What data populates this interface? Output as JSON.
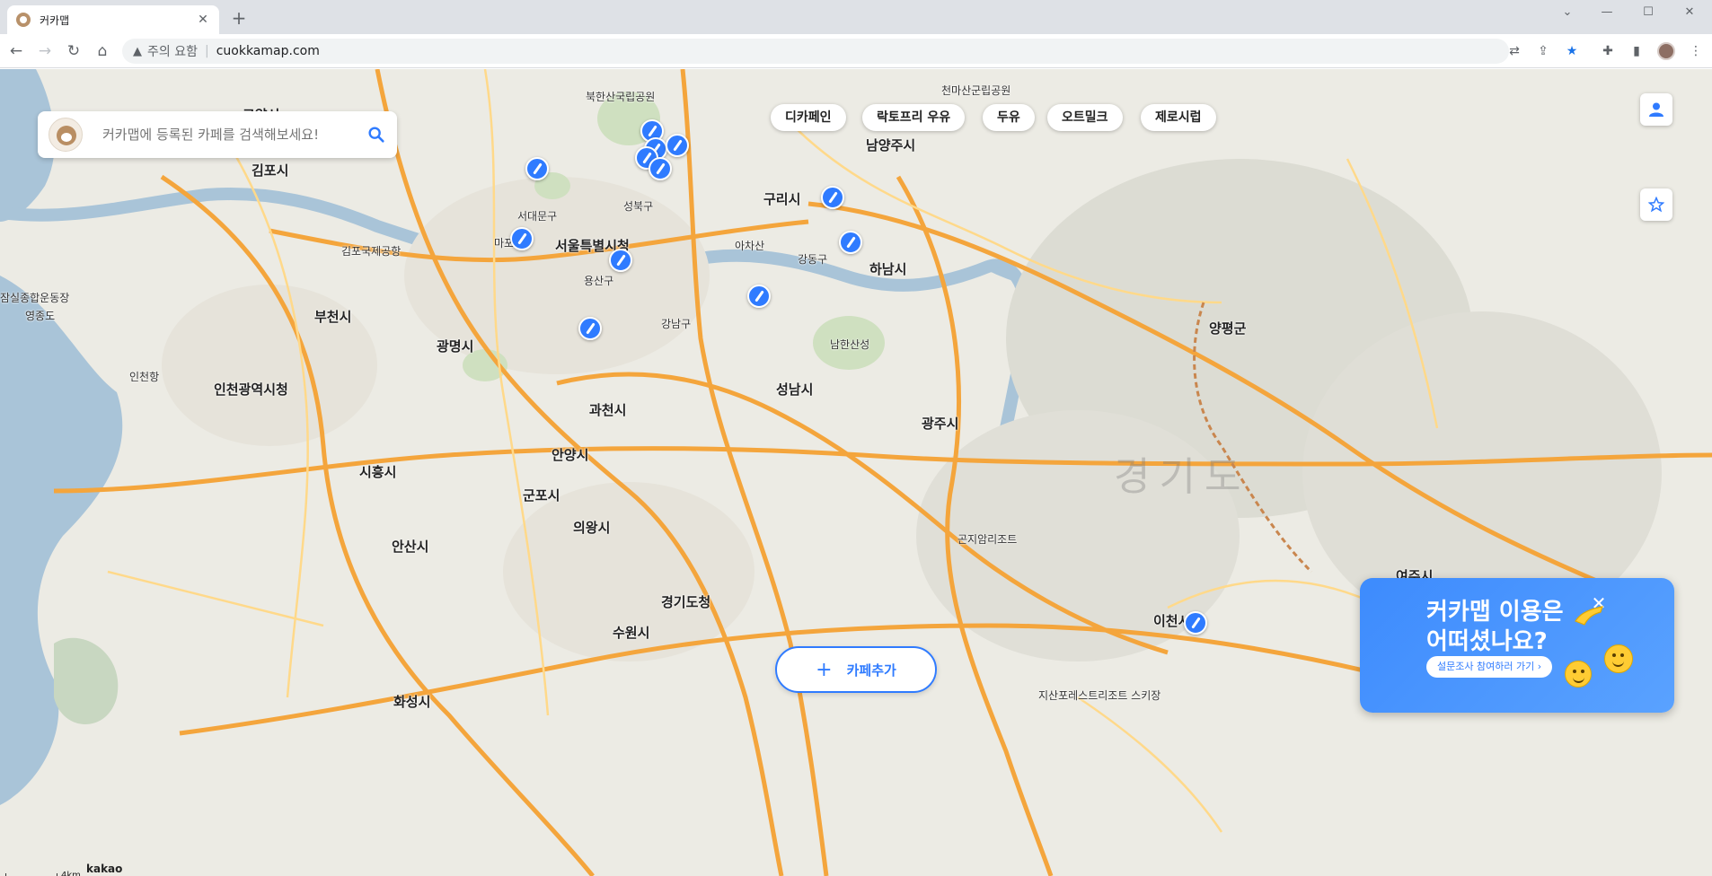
{
  "browser": {
    "tab_title": "커카맵",
    "tab_close": "✕",
    "new_tab": "+",
    "security_warning": "주의 요함",
    "url": "cuokkamap.com"
  },
  "search": {
    "placeholder": "커카맵에 등록된 카페를 검색해보세요!"
  },
  "filters": [
    "디카페인",
    "락토프리 우유",
    "두유",
    "오트밀크",
    "제로시럽"
  ],
  "add_cafe": {
    "label": "카페추가",
    "plus": "+"
  },
  "survey": {
    "line1": "커카맵 이용은",
    "line2": "어떠셨나요?",
    "cta": "설문조사 참여하러 가기 ›",
    "close": "✕"
  },
  "map": {
    "labels": {
      "seoul": "서울특별시청",
      "incheon": "인천광역시청",
      "gyeonggi_office": "경기도청",
      "gyeonggi": "경기도",
      "goyang": "고양시",
      "gimpo": "김포시",
      "bucheon": "부천시",
      "gwangmyeong": "광명시",
      "guri": "구리시",
      "namyangju": "남양주시",
      "hanam": "하남시",
      "seongnam": "성남시",
      "gwangju": "광주시",
      "gwacheon": "과천시",
      "anyang": "안양시",
      "gunpo": "군포시",
      "uiwang": "의왕시",
      "siheung": "시흥시",
      "ansan": "안산시",
      "suwon": "수원시",
      "hwaseong": "화성시",
      "yangpyeong": "양평군",
      "icheon": "이천시",
      "yeoju": "여주시",
      "gimpo_airport": "김포국제공항",
      "namhansanseong": "남한산성",
      "achasan": "아차산",
      "jamsil": "잠실종합운동장",
      "gangnam": "강남구",
      "yongsan": "용산구",
      "mapo": "마포",
      "seodaemun": "서대문구",
      "seongbuk": "성북구",
      "gangdong": "강동구",
      "bukhansan": "북한산국립공원",
      "cheonmasan": "천마산군립공원",
      "gonjiam": "곤지암리조트",
      "jisan": "지산포레스트리조트 스키장",
      "yeongjongdo": "영종도",
      "incheon_port": "인천항"
    },
    "scale": "4km",
    "brand": "kakao"
  },
  "colors": {
    "accent": "#2f7bff",
    "map_bg": "#ecebe4",
    "highway": "#f4a53c",
    "river": "#a9c4d8"
  }
}
